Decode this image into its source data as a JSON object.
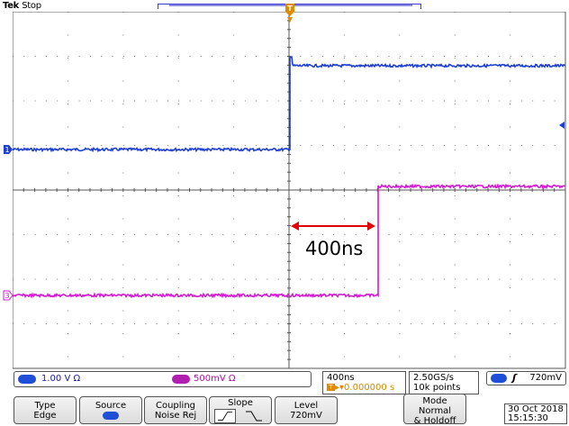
{
  "header": {
    "brand": "Tek",
    "acq_state": "Stop"
  },
  "channels": {
    "ch1": {
      "marker": "1",
      "color": "#1e3fd0",
      "scale": "1.00 V",
      "coupling_symbol": "Ω"
    },
    "ch3": {
      "marker": "3",
      "color": "#d21bd2",
      "scale": "500mV",
      "coupling_symbol": "Ω"
    }
  },
  "horizontal": {
    "timebase": "400ns",
    "trigger_position": "0.000000 s",
    "sample_rate": "2.50GS/s",
    "record_length": "10k points"
  },
  "trigger": {
    "marker": "T",
    "slope_symbol": "ʃ",
    "level": "720mV"
  },
  "annotation": {
    "label": "400ns",
    "arrow_color": "#e00000"
  },
  "softkeys": {
    "type": {
      "title": "Type",
      "value": "Edge"
    },
    "source": {
      "title": "Source",
      "value": "1"
    },
    "coupling": {
      "title": "Coupling",
      "value": "Noise Rej"
    },
    "slope": {
      "title": "Slope"
    },
    "level": {
      "title": "Level",
      "value": "720mV"
    },
    "mode": {
      "title": "Mode",
      "value_1": "Normal",
      "value_2": "& Holdoff"
    }
  },
  "datetime": {
    "date": "30 Oct  2018",
    "time": "15:15:30"
  },
  "colors": {
    "graticule": "#555555",
    "ch1_trace": "#1e3fd0",
    "ch3_trace": "#d21bd2",
    "trigger_marker": "#e08a00"
  }
}
